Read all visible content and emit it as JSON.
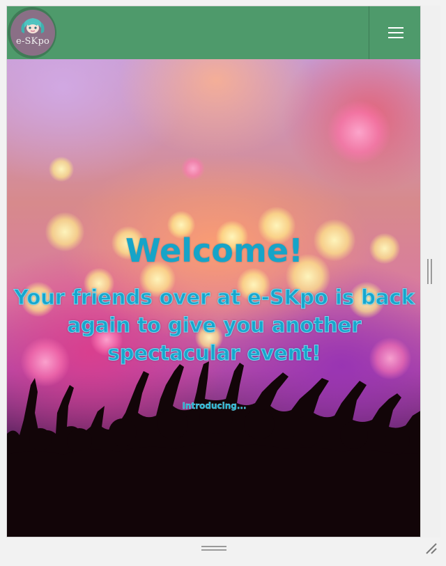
{
  "header": {
    "logo_text": "e-SKpo",
    "logo_icon": "anime-mascot-logo",
    "menu_icon": "hamburger-menu-icon",
    "background_color": "#4e9a6b"
  },
  "hero": {
    "heading": "Welcome!",
    "tagline": "Your friends over at e-SKpo is back again to give you another spectacular event!",
    "subtext": "Introducing...",
    "text_color": "#16a4c8",
    "background_image": "concert-crowd-bokeh-lights"
  },
  "window": {
    "vertical_grip_icon": "vertical-drag-handle-icon",
    "horizontal_grip_icon": "horizontal-drag-handle-icon",
    "resize_icon": "resize-corner-icon"
  }
}
